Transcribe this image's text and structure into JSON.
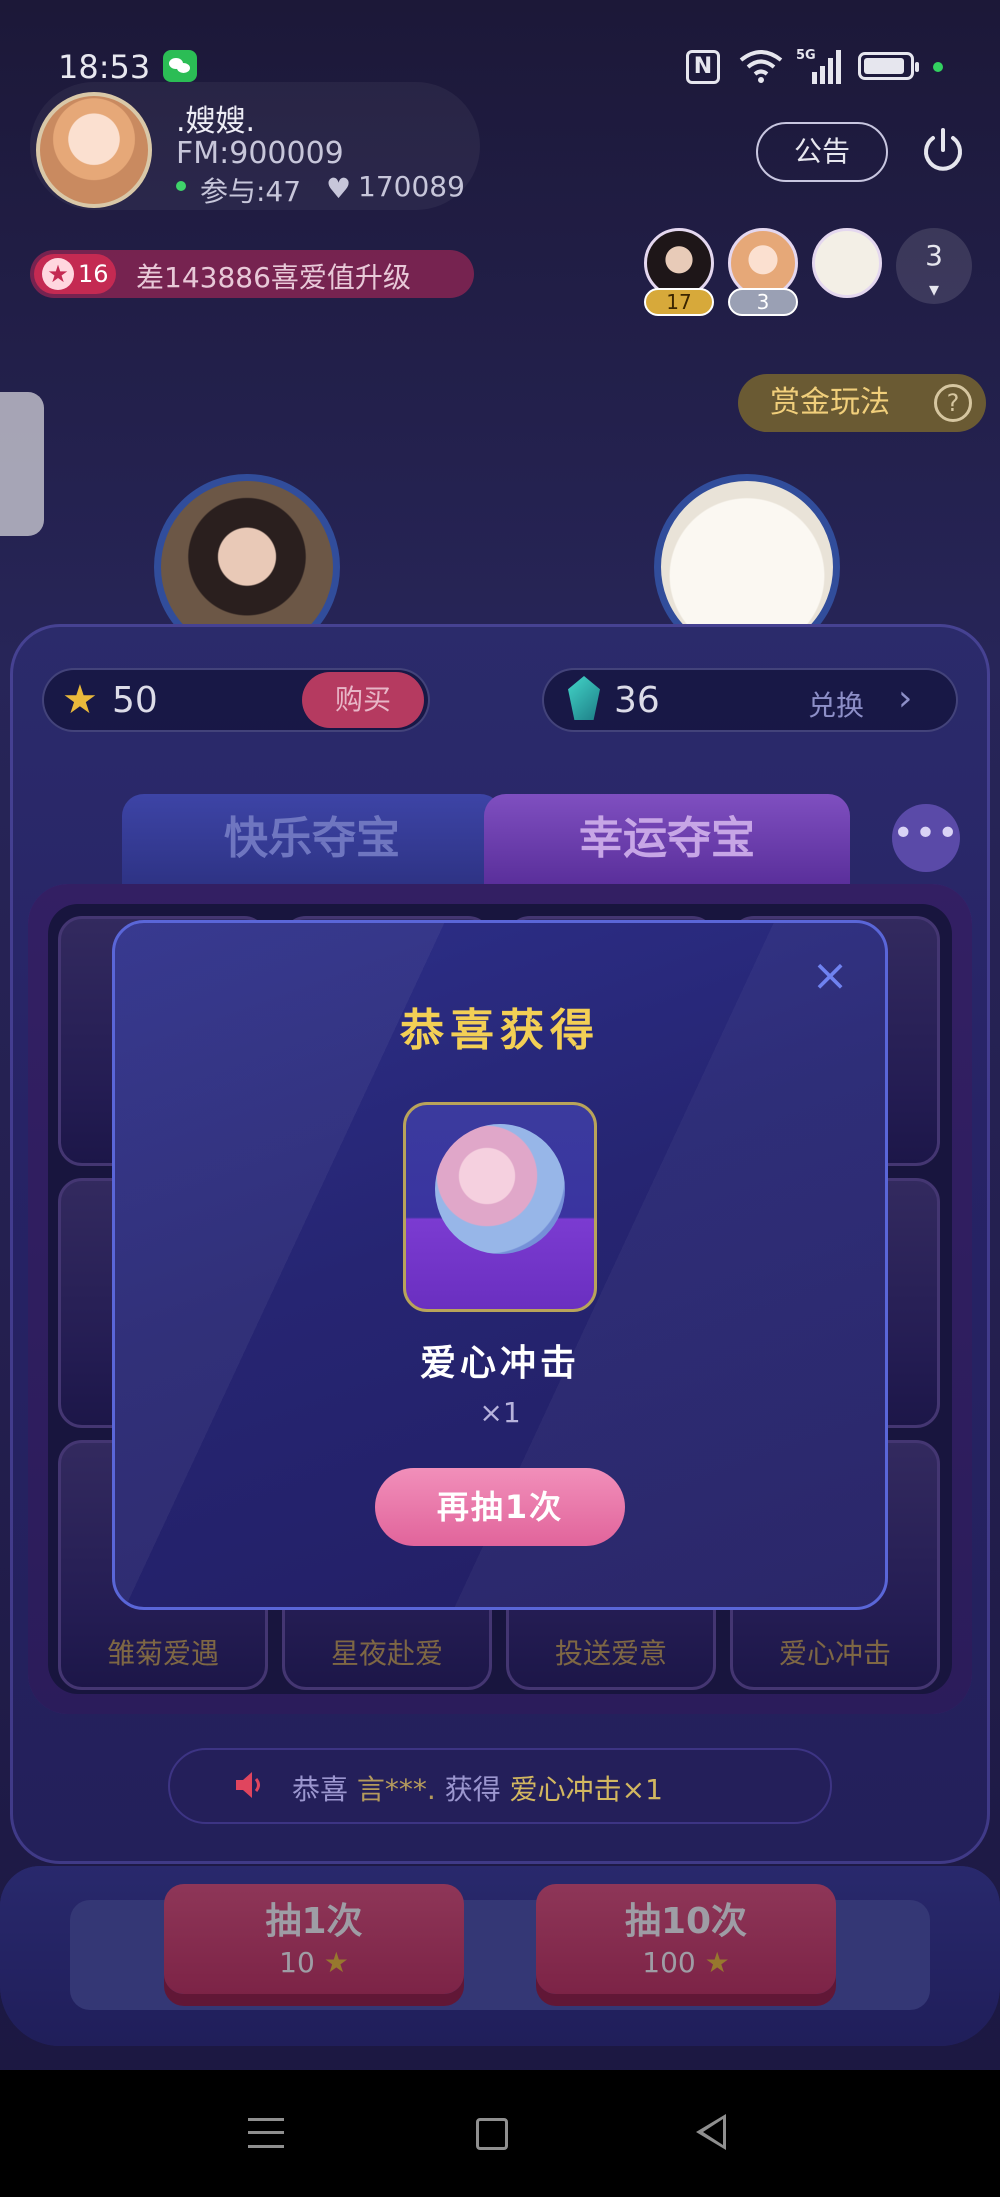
{
  "status_bar": {
    "time": "18:53",
    "network": "5G"
  },
  "room": {
    "host_name": ".嫂嫂.",
    "host_id": "FM:900009",
    "participants": "参与:47",
    "heat": "170089",
    "notice_label": "公告"
  },
  "level": {
    "value": "16",
    "text": "差143886喜爱值升级"
  },
  "online_users": [
    {
      "badge": "17",
      "badge_color": "#d7a93a"
    },
    {
      "badge": "3",
      "badge_color": "#9aa0b4"
    },
    {
      "badge": ""
    }
  ],
  "online_more_count": "3",
  "bounty": {
    "label": "赏金玩法",
    "help": "?"
  },
  "treasure": {
    "coins": "50",
    "buy_label": "购买",
    "gems": "36",
    "exchange_label": "兑换",
    "tabs": [
      {
        "label": "快乐夺宝",
        "active": false
      },
      {
        "label": "幸运夺宝",
        "active": true
      }
    ],
    "more_label": "•••",
    "prizes": [
      {
        "label": "雏菊爱遇"
      },
      {
        "label": "星夜赴爱"
      },
      {
        "label": "投送爱意"
      },
      {
        "label": "爱心冲击"
      }
    ],
    "broadcast": {
      "prefix": "恭喜",
      "user": "言***.",
      "verb": "获得",
      "prize": "爱心冲击×1"
    }
  },
  "draw_buttons": [
    {
      "title": "抽1次",
      "cost": "10"
    },
    {
      "title": "抽10次",
      "cost": "100"
    }
  ],
  "modal": {
    "title": "恭喜获得",
    "prize_name": "爱心冲击",
    "prize_qty": "×1",
    "redraw_label": "再抽1次",
    "close_symbol": "×"
  },
  "colors": {
    "accent_gold": "#f3cf55",
    "accent_pink": "#e1649b",
    "panel_blue": "#2b2b6b"
  }
}
